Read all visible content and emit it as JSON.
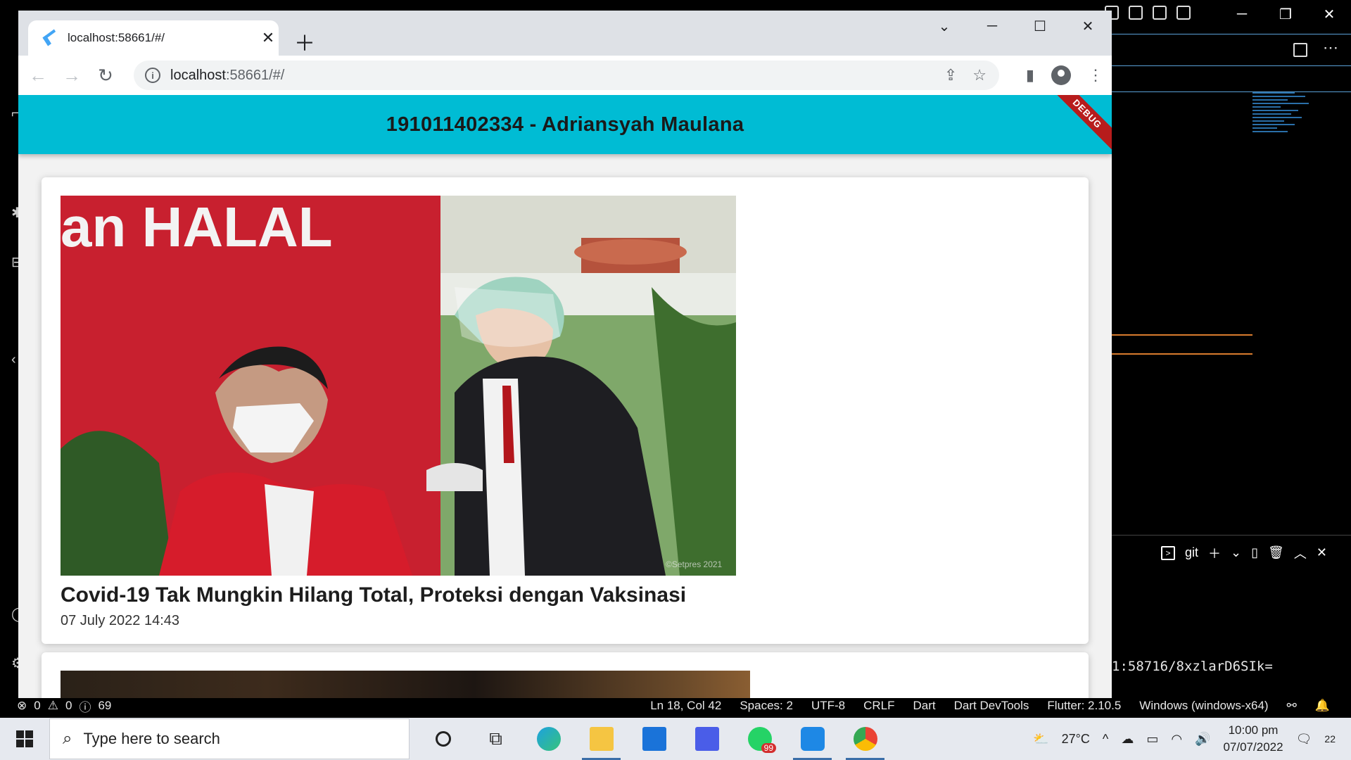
{
  "browser": {
    "tab_title": "localhost:58661/#/",
    "url_host": "localhost",
    "url_rest": ":58661/#/"
  },
  "app": {
    "title": "191011402334 - Adriansyah Maulana",
    "debug_label": "DEBUG",
    "news": [
      {
        "headline": "Covid-19 Tak Mungkin Hilang Total, Proteksi dengan Vaksinasi",
        "date": "07 July 2022 14:43",
        "photo_text": "an HALAL",
        "photo_credit": "©Setpres 2021"
      }
    ]
  },
  "vscode": {
    "terminal_label": "git",
    "terminal_output": "1:58716/8xzlarD6SIk=",
    "status": {
      "errors": "0",
      "warnings": "0",
      "infos": "69",
      "position": "Ln 18, Col 42",
      "spaces": "Spaces: 2",
      "encoding": "UTF-8",
      "eol": "CRLF",
      "language": "Dart",
      "devtools": "Dart DevTools",
      "flutter": "Flutter: 2.10.5",
      "device": "Windows (windows-x64)"
    }
  },
  "taskbar": {
    "search_placeholder": "Type here to search",
    "temperature": "27°C",
    "time": "10:00 pm",
    "date": "07/07/2022",
    "notifications": "22",
    "whatsapp_badge": "99"
  }
}
